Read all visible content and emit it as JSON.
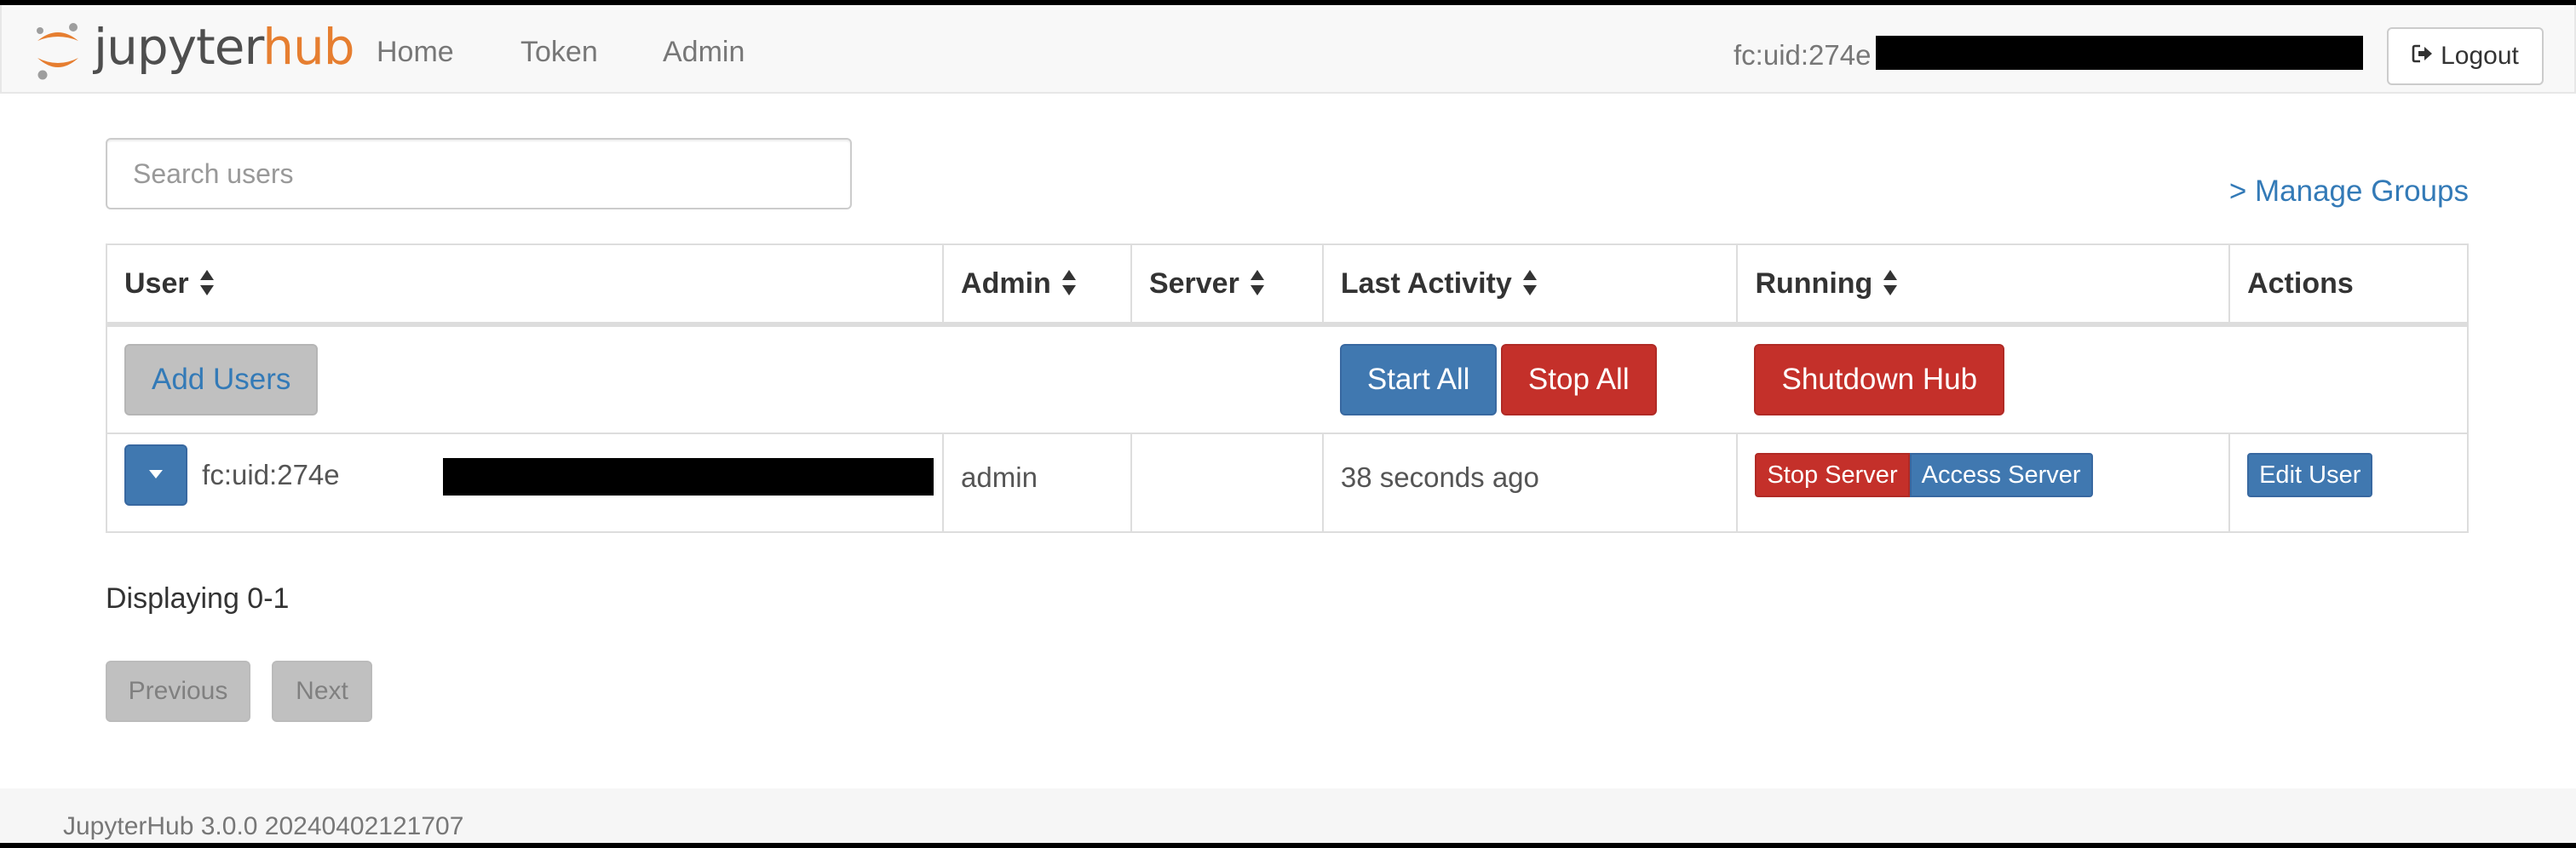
{
  "navbar": {
    "logo": {
      "text_primary": "jupyter",
      "text_accent": "hub",
      "accent_color": "#e67e30"
    },
    "links": [
      {
        "label": "Home"
      },
      {
        "label": "Token"
      },
      {
        "label": "Admin"
      }
    ],
    "current_user": "fc:uid:274e",
    "current_user_redacted": true,
    "logout": {
      "label": "Logout",
      "icon": "sign-out-icon"
    }
  },
  "search": {
    "placeholder": "Search users",
    "value": ""
  },
  "manage_groups": {
    "label": "> Manage Groups"
  },
  "table": {
    "columns": [
      {
        "label": "User",
        "sortable": true
      },
      {
        "label": "Admin",
        "sortable": true
      },
      {
        "label": "Server",
        "sortable": true
      },
      {
        "label": "Last Activity",
        "sortable": true
      },
      {
        "label": "Running",
        "sortable": true
      },
      {
        "label": "Actions",
        "sortable": false
      }
    ],
    "bulk_actions": {
      "add_users": "Add Users",
      "start_all": "Start All",
      "stop_all": "Stop All",
      "shutdown_hub": "Shutdown Hub"
    },
    "rows": [
      {
        "user": "fc:uid:274e",
        "user_redacted": true,
        "admin": "admin",
        "server": "",
        "last_activity": "38 seconds ago",
        "running_actions": {
          "stop": "Stop Server",
          "access": "Access Server"
        },
        "actions": {
          "edit": "Edit User"
        }
      }
    ]
  },
  "pagination": {
    "status": "Displaying 0-1",
    "previous": "Previous",
    "next": "Next"
  },
  "footer": {
    "version": "JupyterHub 3.0.0 20240402121707"
  },
  "colors": {
    "primary": "#4078b0",
    "danger": "#c4302a",
    "link": "#337ab7",
    "navbar_bg": "#f8f8f8"
  }
}
